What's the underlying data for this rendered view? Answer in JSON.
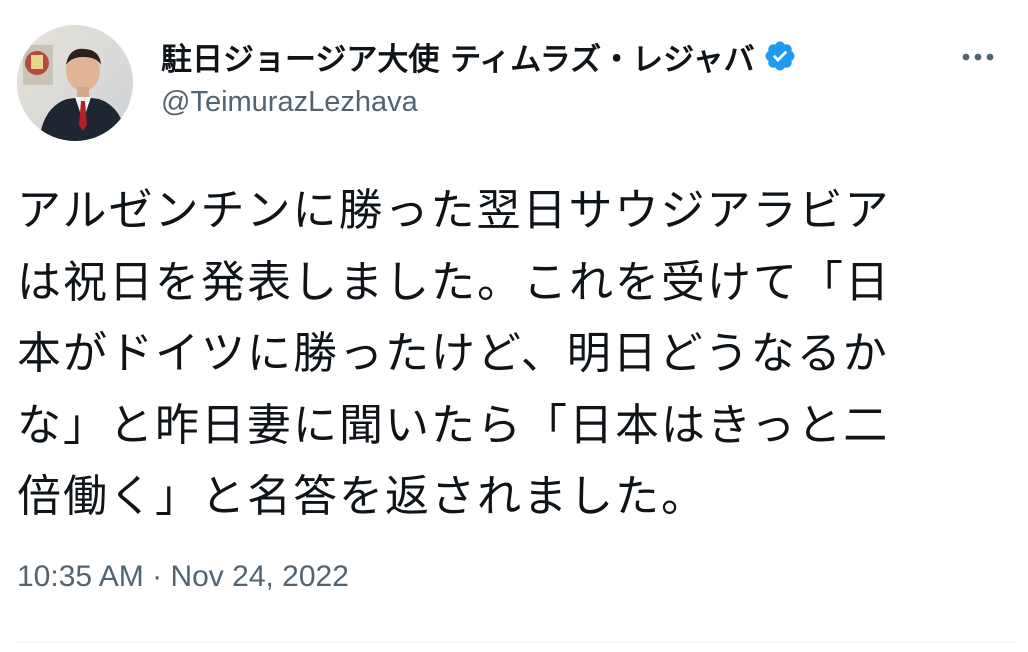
{
  "author": {
    "display_name": "駐日ジョージア大使 ティムラズ・レジャバ",
    "handle": "@TeimurazLezhava",
    "verified_icon": "verified-badge-icon",
    "avatar": "avatar-photo"
  },
  "tweet": {
    "lines": [
      "アルゼンチンに勝った翌日サウジアラビア",
      "は祝日を発表しました。これを受けて「日",
      "本がドイツに勝ったけど、明日どうなるか",
      "な」と昨日妻に聞いたら「日本はきっと二",
      "倍働く」と名答を返されました。"
    ],
    "time": "10:35 AM",
    "separator": "·",
    "date": "Nov 24, 2022"
  },
  "menu": {
    "icon": "more-horizontal-icon"
  },
  "colors": {
    "text": "#0f1419",
    "secondary": "#536471",
    "verified_blue": "#1d9bf0",
    "divider": "#eff3f4"
  }
}
